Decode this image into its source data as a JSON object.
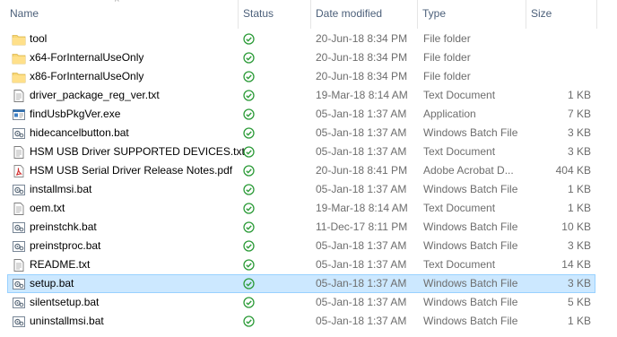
{
  "columns": {
    "name": "Name",
    "status": "Status",
    "date": "Date modified",
    "type": "Type",
    "size": "Size"
  },
  "sort_indicator": "^",
  "colors": {
    "folder": "#f8d775",
    "status_ok": "#2e9c3a",
    "selection_bg": "#cce8ff",
    "selection_border": "#99d1ff",
    "header_text": "#4c607a"
  },
  "files": [
    {
      "name": "tool",
      "date": "20-Jun-18 8:34 PM",
      "type": "File folder",
      "size": "",
      "icon": "folder-icon",
      "status": "synced-icon"
    },
    {
      "name": "x64-ForInternalUseOnly",
      "date": "20-Jun-18 8:34 PM",
      "type": "File folder",
      "size": "",
      "icon": "folder-icon",
      "status": "synced-icon"
    },
    {
      "name": "x86-ForInternalUseOnly",
      "date": "20-Jun-18 8:34 PM",
      "type": "File folder",
      "size": "",
      "icon": "folder-icon",
      "status": "synced-icon"
    },
    {
      "name": "driver_package_reg_ver.txt",
      "date": "19-Mar-18 8:14 AM",
      "type": "Text Document",
      "size": "1 KB",
      "icon": "text-file-icon",
      "status": "synced-icon"
    },
    {
      "name": "findUsbPkgVer.exe",
      "date": "05-Jan-18 1:37 AM",
      "type": "Application",
      "size": "7 KB",
      "icon": "application-icon",
      "status": "synced-icon"
    },
    {
      "name": "hidecancelbutton.bat",
      "date": "05-Jan-18 1:37 AM",
      "type": "Windows Batch File",
      "size": "3 KB",
      "icon": "batch-file-icon",
      "status": "synced-icon"
    },
    {
      "name": "HSM USB Driver SUPPORTED DEVICES.txt",
      "date": "05-Jan-18 1:37 AM",
      "type": "Text Document",
      "size": "3 KB",
      "icon": "text-file-icon",
      "status": "synced-icon"
    },
    {
      "name": "HSM USB Serial Driver Release Notes.pdf",
      "date": "20-Jun-18 8:41 PM",
      "type": "Adobe Acrobat D...",
      "size": "404 KB",
      "icon": "pdf-file-icon",
      "status": "synced-icon"
    },
    {
      "name": "installmsi.bat",
      "date": "05-Jan-18 1:37 AM",
      "type": "Windows Batch File",
      "size": "1 KB",
      "icon": "batch-file-icon",
      "status": "synced-icon"
    },
    {
      "name": "oem.txt",
      "date": "19-Mar-18 8:14 AM",
      "type": "Text Document",
      "size": "1 KB",
      "icon": "text-file-icon",
      "status": "synced-icon"
    },
    {
      "name": "preinstchk.bat",
      "date": "11-Dec-17 8:11 PM",
      "type": "Windows Batch File",
      "size": "10 KB",
      "icon": "batch-file-icon",
      "status": "synced-icon"
    },
    {
      "name": "preinstproc.bat",
      "date": "05-Jan-18 1:37 AM",
      "type": "Windows Batch File",
      "size": "3 KB",
      "icon": "batch-file-icon",
      "status": "synced-icon"
    },
    {
      "name": "README.txt",
      "date": "05-Jan-18 1:37 AM",
      "type": "Text Document",
      "size": "14 KB",
      "icon": "text-file-icon",
      "status": "synced-icon"
    },
    {
      "name": "setup.bat",
      "date": "05-Jan-18 1:37 AM",
      "type": "Windows Batch File",
      "size": "3 KB",
      "icon": "batch-file-icon",
      "status": "synced-icon",
      "selected": true
    },
    {
      "name": "silentsetup.bat",
      "date": "05-Jan-18 1:37 AM",
      "type": "Windows Batch File",
      "size": "5 KB",
      "icon": "batch-file-icon",
      "status": "synced-icon"
    },
    {
      "name": "uninstallmsi.bat",
      "date": "05-Jan-18 1:37 AM",
      "type": "Windows Batch File",
      "size": "1 KB",
      "icon": "batch-file-icon",
      "status": "synced-icon"
    }
  ]
}
